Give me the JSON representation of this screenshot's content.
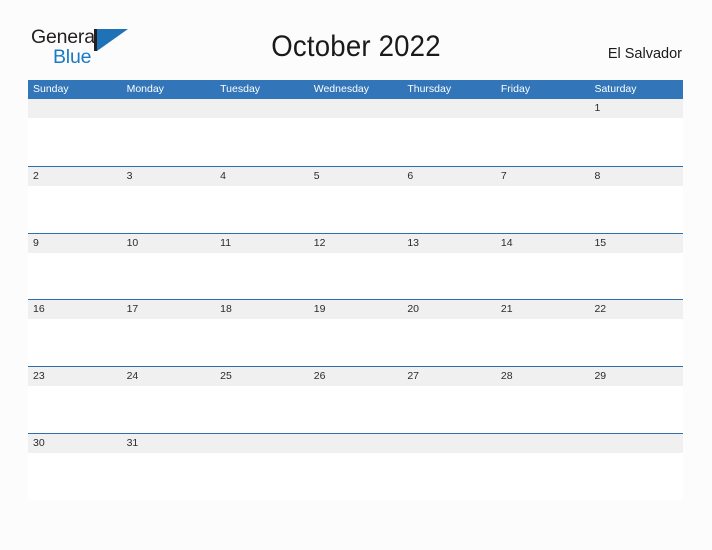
{
  "brand": {
    "name_part1": "General",
    "name_part2": "Blue",
    "mark_icon": "flag-triangle-icon",
    "color_blue": "#1a7ac4",
    "color_dark": "#231f20"
  },
  "header": {
    "title": "October 2022",
    "country": "El Salvador"
  },
  "calendar": {
    "header_bg": "#3275b8",
    "date_band_bg": "#f0f0f0",
    "rule_color": "#2f6fae",
    "weekdays": [
      "Sunday",
      "Monday",
      "Tuesday",
      "Wednesday",
      "Thursday",
      "Friday",
      "Saturday"
    ],
    "weeks": [
      [
        "",
        "",
        "",
        "",
        "",
        "",
        "1"
      ],
      [
        "2",
        "3",
        "4",
        "5",
        "6",
        "7",
        "8"
      ],
      [
        "9",
        "10",
        "11",
        "12",
        "13",
        "14",
        "15"
      ],
      [
        "16",
        "17",
        "18",
        "19",
        "20",
        "21",
        "22"
      ],
      [
        "23",
        "24",
        "25",
        "26",
        "27",
        "28",
        "29"
      ],
      [
        "30",
        "31",
        "",
        "",
        "",
        "",
        ""
      ]
    ]
  }
}
